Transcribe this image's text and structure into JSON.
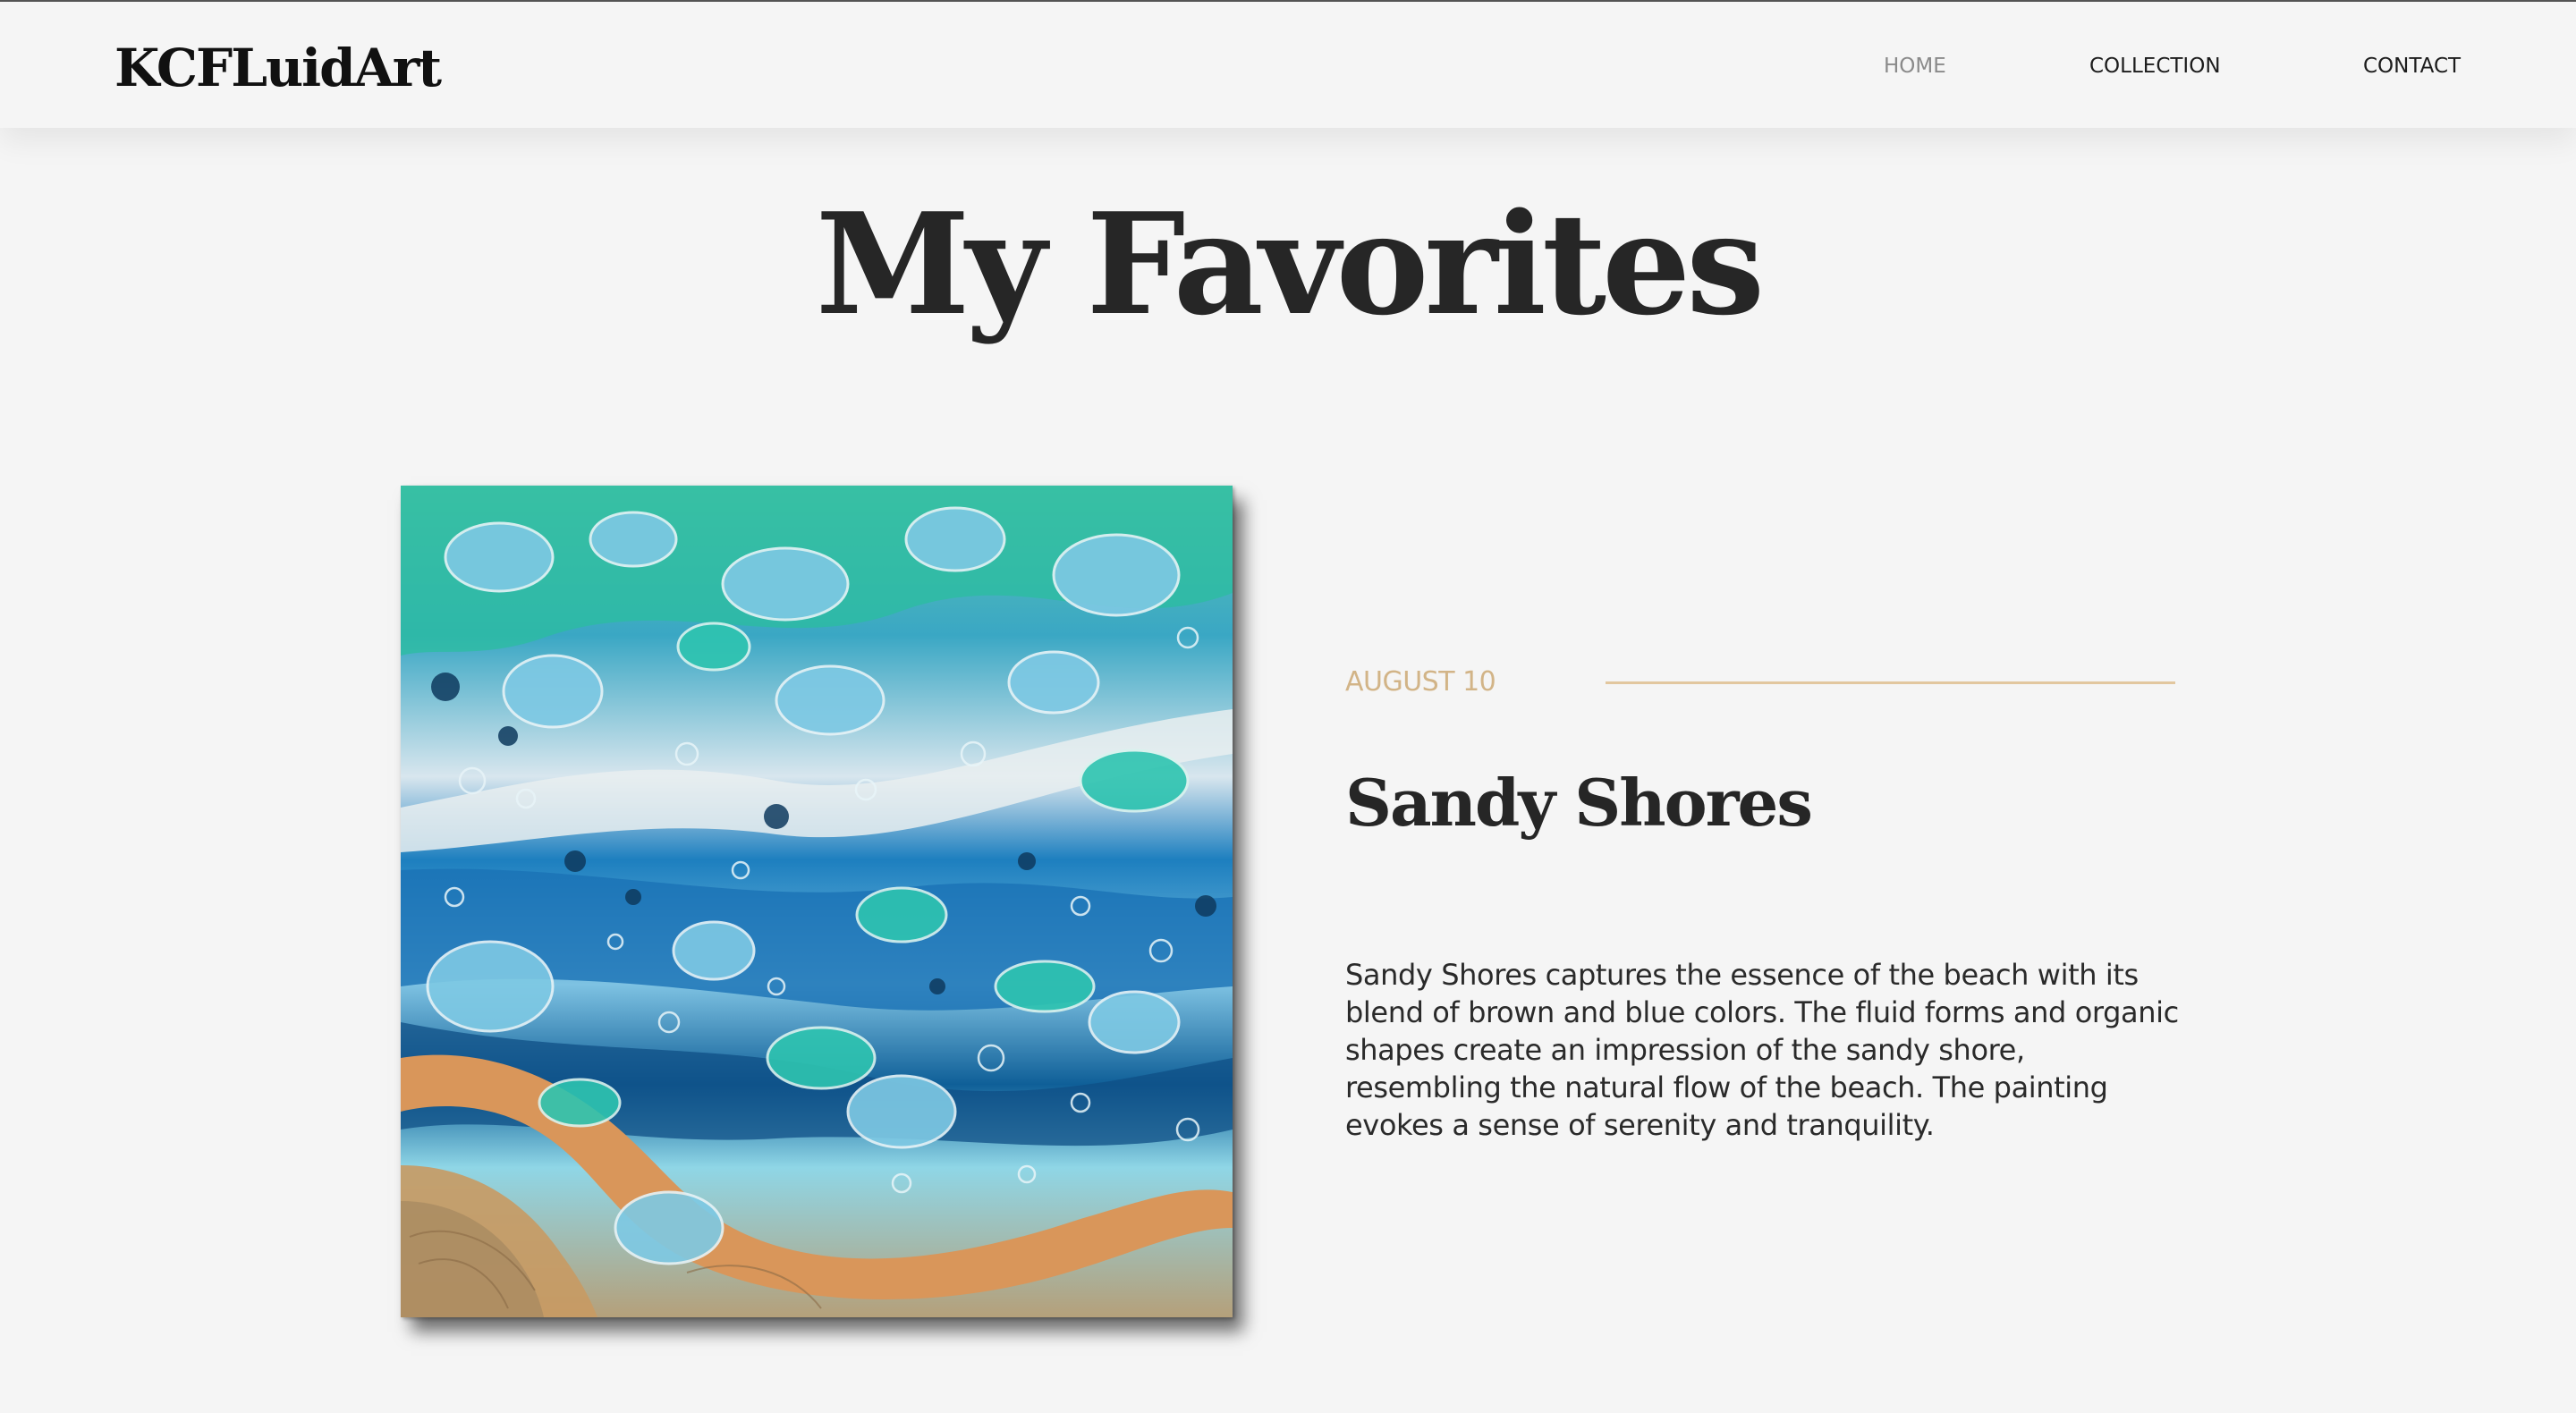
{
  "site": {
    "logo": "KCFLuidArt",
    "nav": [
      {
        "label": "HOME",
        "active": true
      },
      {
        "label": "COLLECTION",
        "active": false
      },
      {
        "label": "CONTACT",
        "active": false
      }
    ]
  },
  "page": {
    "title": "My Favorites"
  },
  "featured": {
    "date": "AUGUST 10",
    "title": "Sandy Shores",
    "description": "Sandy Shores captures the essence of the beach with its blend of brown and blue colors. The fluid forms and organic shapes create an impression of the sandy shore, resembling the natural flow of the beach. The painting evokes a sense of serenity and tranquility.",
    "image_palette": [
      "#1f7fb8",
      "#2ec4b0",
      "#d9965a",
      "#a9dcec",
      "#0e4f80",
      "#e8e2d8"
    ]
  },
  "colors": {
    "background": "#f5f5f5",
    "accent": "#d2b487",
    "text": "#2a2a2a",
    "nav_active": "#8a8a8a"
  }
}
